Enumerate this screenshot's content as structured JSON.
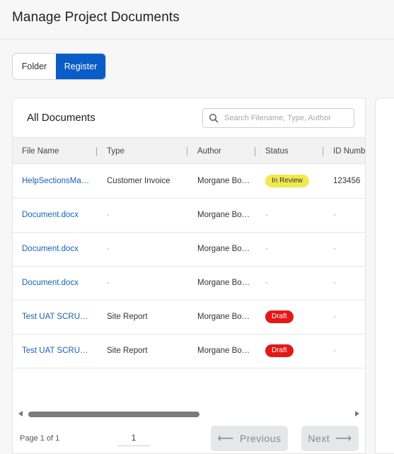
{
  "page": {
    "title": "Manage Project Documents"
  },
  "view_toggle": {
    "folder_label": "Folder",
    "register_label": "Register"
  },
  "documents": {
    "title": "All Documents",
    "search_placeholder": "Search Filename, Type, Author",
    "columns": [
      "File Name",
      "Type",
      "Author",
      "Status",
      "ID Numb"
    ],
    "rows": [
      {
        "file": "HelpSectionsMa…",
        "type": "Customer Invoice",
        "author": "Morgane Bo…",
        "status": "In Review",
        "status_kind": "review",
        "id": "123456"
      },
      {
        "file": "Document.docx",
        "type": "-",
        "author": "Morgane Bo…",
        "status": "-",
        "status_kind": "none",
        "id": "-"
      },
      {
        "file": "Document.docx",
        "type": "-",
        "author": "Morgane Bo…",
        "status": "-",
        "status_kind": "none",
        "id": "-"
      },
      {
        "file": "Document.docx",
        "type": "-",
        "author": "Morgane Bo…",
        "status": "-",
        "status_kind": "none",
        "id": "-"
      },
      {
        "file": "Test UAT SCRU…",
        "type": "Site Report",
        "author": "Morgane Bo…",
        "status": "Draft",
        "status_kind": "draft",
        "id": "-"
      },
      {
        "file": "Test UAT SCRU…",
        "type": "Site Report",
        "author": "Morgane Bo…",
        "status": "Draft",
        "status_kind": "draft",
        "id": "-"
      }
    ]
  },
  "pagination": {
    "page_text": "Page 1 of 1",
    "current_page": "1",
    "previous_label": "Previous",
    "next_label": "Next"
  },
  "colors": {
    "primary": "#0a5cc6",
    "link": "#1b5fb5",
    "review_badge": "#f2e94f",
    "draft_badge": "#e31818"
  }
}
